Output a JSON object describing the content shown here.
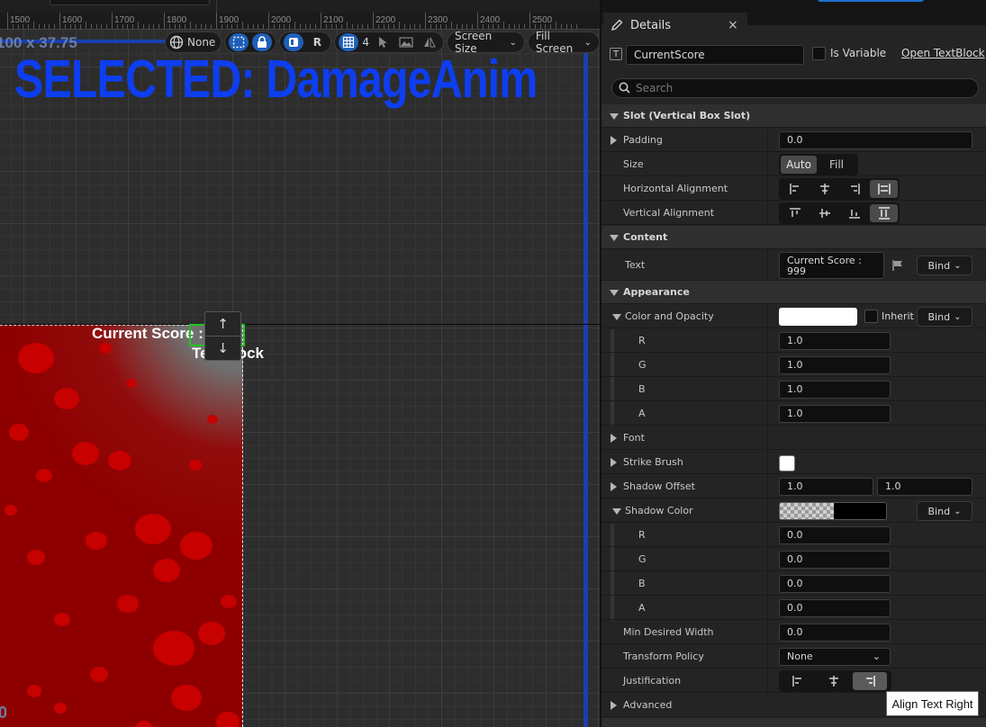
{
  "ruler": {
    "ticks": [
      "1500",
      "1600",
      "1700",
      "1800",
      "1900",
      "2000",
      "2100",
      "2200",
      "2300",
      "2400",
      "2500"
    ]
  },
  "canvas": {
    "dimensions_text": "100 x 37.75",
    "selected_banner": "SELECTED: DamageAnim",
    "score_text": "Current Score : 999",
    "textblock_label": "TextBlock",
    "corner_text": "0",
    "toolbar": {
      "locale_label": "None",
      "r_label": "R",
      "grid_label": "4",
      "screen_size_label": "Screen Size",
      "fill_screen_label": "Fill Screen"
    },
    "nudge_up": "↑",
    "nudge_down": "↓"
  },
  "panel": {
    "tab_title": "Details",
    "tab_close": "×",
    "name_icon": "T",
    "widget_name": "CurrentScore",
    "is_variable_label": "Is Variable",
    "open_textblock_link": "Open TextBlock",
    "search_placeholder": "Search",
    "slot_header": "Slot (Vertical Box Slot)",
    "padding_label": "Padding",
    "padding_value": "0.0",
    "size_label": "Size",
    "size_options": [
      "Auto",
      "Fill"
    ],
    "size_selected": "Auto",
    "halign_label": "Horizontal Alignment",
    "halign_selected": "fill",
    "valign_label": "Vertical Alignment",
    "valign_selected": "fill",
    "content_header": "Content",
    "text_label": "Text",
    "text_value": "Current Score : 999",
    "bind_label": "Bind",
    "appearance_header": "Appearance",
    "color_opacity_label": "Color and Opacity",
    "color_opacity_value": "#ffffff",
    "inherit_label": "Inherit",
    "rgba_labels": [
      "R",
      "G",
      "B",
      "A"
    ],
    "color_rgba": [
      "1.0",
      "1.0",
      "1.0",
      "1.0"
    ],
    "font_label": "Font",
    "strike_brush_label": "Strike Brush",
    "shadow_offset_label": "Shadow Offset",
    "shadow_offset": [
      "1.0",
      "1.0"
    ],
    "shadow_color_label": "Shadow Color",
    "shadow_color_value": "#000000",
    "shadow_rgba": [
      "0.0",
      "0.0",
      "0.0",
      "0.0"
    ],
    "min_width_label": "Min Desired Width",
    "min_width_value": "0.0",
    "transform_policy_label": "Transform Policy",
    "transform_policy_value": "None",
    "justification_label": "Justification",
    "justification_selected": "right",
    "advanced_label": "Advanced"
  },
  "tooltip": "Align Text Right",
  "colors": {
    "accent": "#1f5fb8",
    "banner": "#0d3ef0",
    "selection": "#21c321"
  }
}
